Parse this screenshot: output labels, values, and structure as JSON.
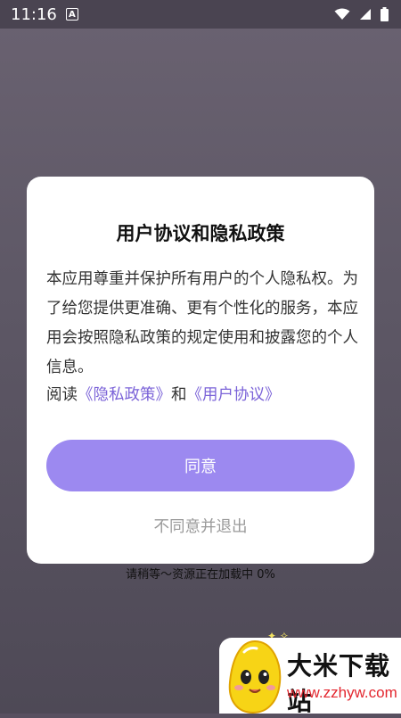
{
  "status_bar": {
    "time": "11:16",
    "icons": [
      "a-icon",
      "wifi-icon",
      "signal-icon",
      "battery-icon"
    ]
  },
  "dialog": {
    "title": "用户协议和隐私政策",
    "body": "本应用尊重并保护所有用户的个人隐私权。为了给您提供更准确、更有个性化的服务，本应用会按照隐私政策的规定使用和披露您的个人信息。",
    "read_prefix": "阅读",
    "privacy_link": "《隐私政策》",
    "and": "和",
    "user_agreement_link": "《用户协议》",
    "agree_button": "同意",
    "disagree_button": "不同意并退出"
  },
  "loading_text": "请稍等～资源正在加载中 0%",
  "watermark": {
    "brand": "大米下载站",
    "url": "www.zzhyw.com"
  },
  "colors": {
    "accent": "#9c89f0",
    "link": "#7b63d8",
    "overlay": "#5e5866",
    "watermark_url": "#e3262e"
  }
}
